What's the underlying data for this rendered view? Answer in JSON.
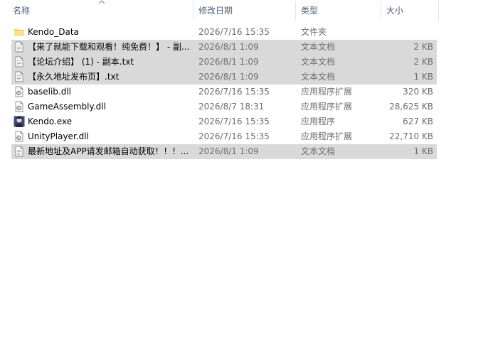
{
  "columns": {
    "name": "名称",
    "date": "修改日期",
    "type": "类型",
    "size": "大小"
  },
  "files": [
    {
      "icon": "folder-icon",
      "name": "Kendo_Data",
      "date": "2026/7/16 15:35",
      "type": "文件夹",
      "size": "",
      "selected": false
    },
    {
      "icon": "text-file-icon",
      "name": "【来了就能下载和观看！纯免费！】 - 副...",
      "date": "2026/8/1 1:09",
      "type": "文本文档",
      "size": "2 KB",
      "selected": true
    },
    {
      "icon": "text-file-icon",
      "name": "【论坛介绍】 (1) - 副本.txt",
      "date": "2026/8/1 1:09",
      "type": "文本文档",
      "size": "2 KB",
      "selected": true
    },
    {
      "icon": "text-file-icon",
      "name": "【永久地址发布页】.txt",
      "date": "2026/8/1 1:09",
      "type": "文本文档",
      "size": "1 KB",
      "selected": true
    },
    {
      "icon": "dll-file-icon",
      "name": "baselib.dll",
      "date": "2026/7/16 15:35",
      "type": "应用程序扩展",
      "size": "320 KB",
      "selected": false
    },
    {
      "icon": "dll-file-icon",
      "name": "GameAssembly.dll",
      "date": "2026/8/7 18:31",
      "type": "应用程序扩展",
      "size": "28,625 KB",
      "selected": false
    },
    {
      "icon": "app-exe-icon",
      "name": "Kendo.exe",
      "date": "2026/7/16 15:35",
      "type": "应用程序",
      "size": "627 KB",
      "selected": false
    },
    {
      "icon": "dll-file-icon",
      "name": "UnityPlayer.dll",
      "date": "2026/7/16 15:35",
      "type": "应用程序扩展",
      "size": "22,710 KB",
      "selected": false
    },
    {
      "icon": "text-file-icon",
      "name": "最新地址及APP请发邮箱自动获取！！！...",
      "date": "2026/8/1 1:09",
      "type": "文本文档",
      "size": "1 KB",
      "selected": true
    }
  ]
}
